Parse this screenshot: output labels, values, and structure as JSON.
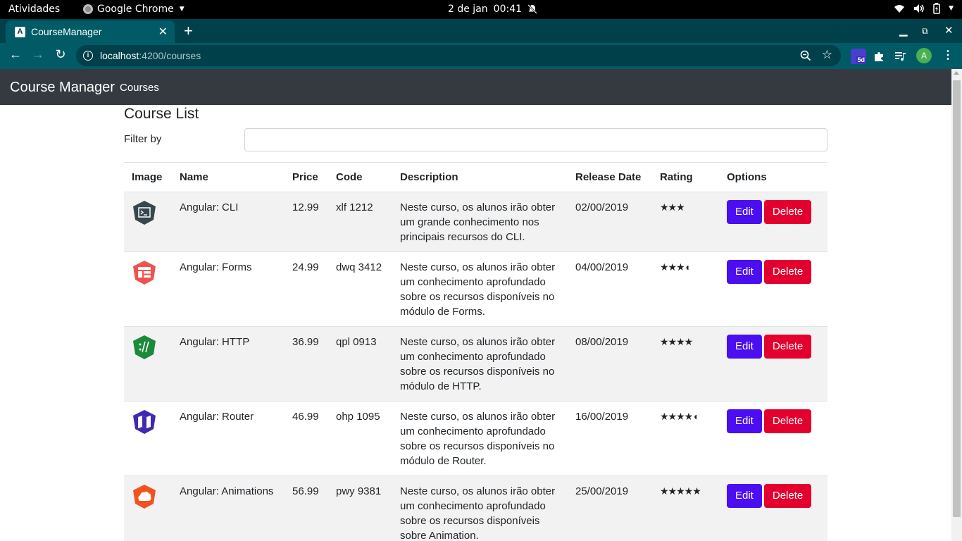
{
  "os": {
    "activities": "Atividades",
    "app_name": "Google Chrome",
    "date": "2 de jan",
    "time": "00:41"
  },
  "browser": {
    "tab_title": "CourseManager",
    "tab_favicon": "A",
    "url_host": "localhost",
    "url_rest": ":4200/courses",
    "avatar_letter": "A",
    "ext_badge": "5d"
  },
  "app": {
    "brand": "Course Manager",
    "nav_courses": "Courses"
  },
  "page": {
    "title": "Course List",
    "filter_label": "Filter by",
    "filter_value": ""
  },
  "table": {
    "headers": [
      "Image",
      "Name",
      "Price",
      "Code",
      "Description",
      "Release Date",
      "Rating",
      "Options"
    ],
    "edit_label": "Edit",
    "delete_label": "Delete",
    "rows": [
      {
        "icon": "angular-cli-icon",
        "icon_color": "#37474f",
        "name": "Angular: CLI",
        "price": "12.99",
        "code": "xlf 1212",
        "description": "Neste curso, os alunos irão obter um grande conhecimento nos principais recursos do CLI.",
        "release_date": "02/00/2019",
        "rating": 3.0,
        "stars": "★★★"
      },
      {
        "icon": "angular-forms-icon",
        "icon_color": "#ef5350",
        "name": "Angular: Forms",
        "price": "24.99",
        "code": "dwq 3412",
        "description": "Neste curso, os alunos irão obter um conhecimento aprofundado sobre os recursos disponíveis no módulo de Forms.",
        "release_date": "04/00/2019",
        "rating": 3.5,
        "stars": "★★★◖"
      },
      {
        "icon": "angular-http-icon",
        "icon_color": "#1b8a3a",
        "name": "Angular: HTTP",
        "price": "36.99",
        "code": "qpl 0913",
        "description": "Neste curso, os alunos irão obter um conhecimento aprofundado sobre os recursos disponíveis no módulo de HTTP.",
        "release_date": "08/00/2019",
        "rating": 4.0,
        "stars": "★★★★"
      },
      {
        "icon": "angular-router-icon",
        "icon_color": "#3f2ab5",
        "name": "Angular: Router",
        "price": "46.99",
        "code": "ohp 1095",
        "description": "Neste curso, os alunos irão obter um conhecimento aprofundado sobre os recursos disponíveis no módulo de Router.",
        "release_date": "16/00/2019",
        "rating": 4.5,
        "stars": "★★★★◖"
      },
      {
        "icon": "angular-animations-icon",
        "icon_color": "#f4511e",
        "name": "Angular: Animations",
        "price": "56.99",
        "code": "pwy 9381",
        "description": "Neste curso, os alunos irão obter um conhecimento aprofundado sobre os recursos disponíveis sobre Animation.",
        "release_date": "25/00/2019",
        "rating": 5.0,
        "stars": "★★★★★"
      }
    ]
  }
}
